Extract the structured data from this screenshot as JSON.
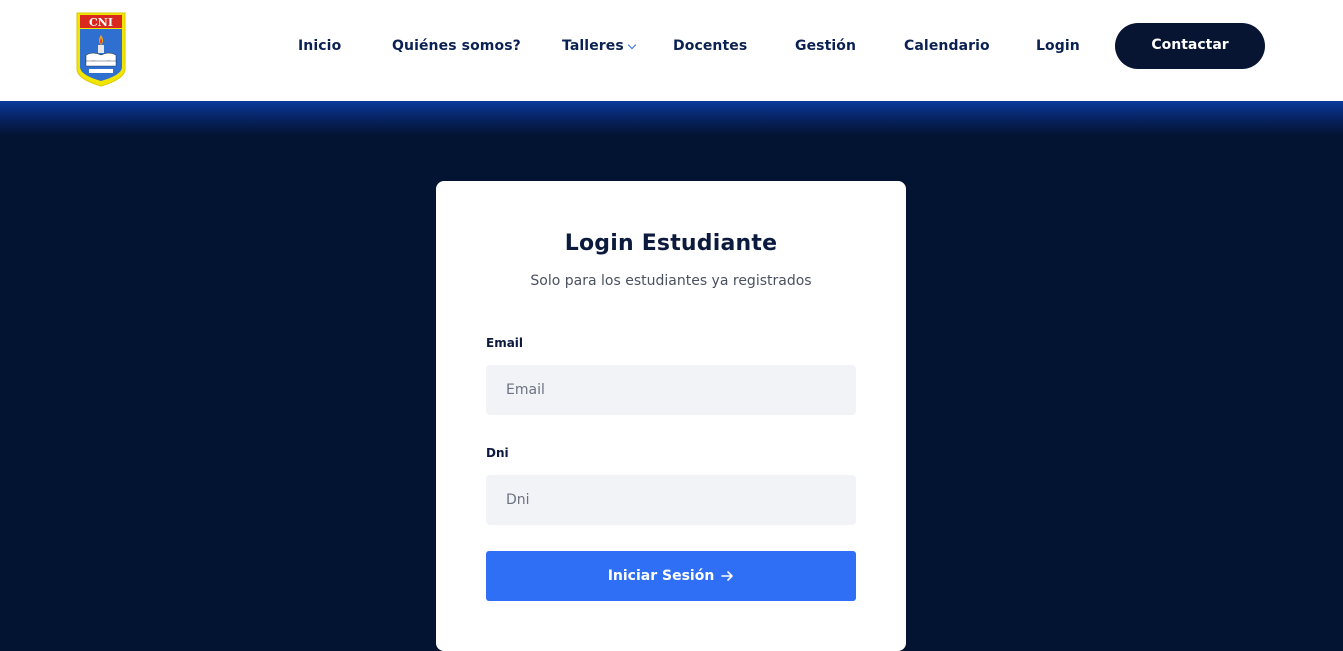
{
  "header": {
    "logo_text": "CNI",
    "nav": [
      {
        "label": "Inicio"
      },
      {
        "label": "Quiénes somos?"
      },
      {
        "label": "Talleres"
      },
      {
        "label": "Docentes"
      },
      {
        "label": "Gestión"
      },
      {
        "label": "Calendario"
      },
      {
        "label": "Login"
      }
    ],
    "contact_label": "Contactar"
  },
  "login": {
    "title": "Login Estudiante",
    "subtitle": "Solo para los estudiantes ya registrados",
    "email_label": "Email",
    "email_placeholder": "Email",
    "dni_label": "Dni",
    "dni_placeholder": "Dni",
    "submit_label": "Iniciar Sesión"
  },
  "colors": {
    "nav_text": "#0b2153",
    "dark_bg": "#031433",
    "button_blue": "#2f6ff5"
  }
}
